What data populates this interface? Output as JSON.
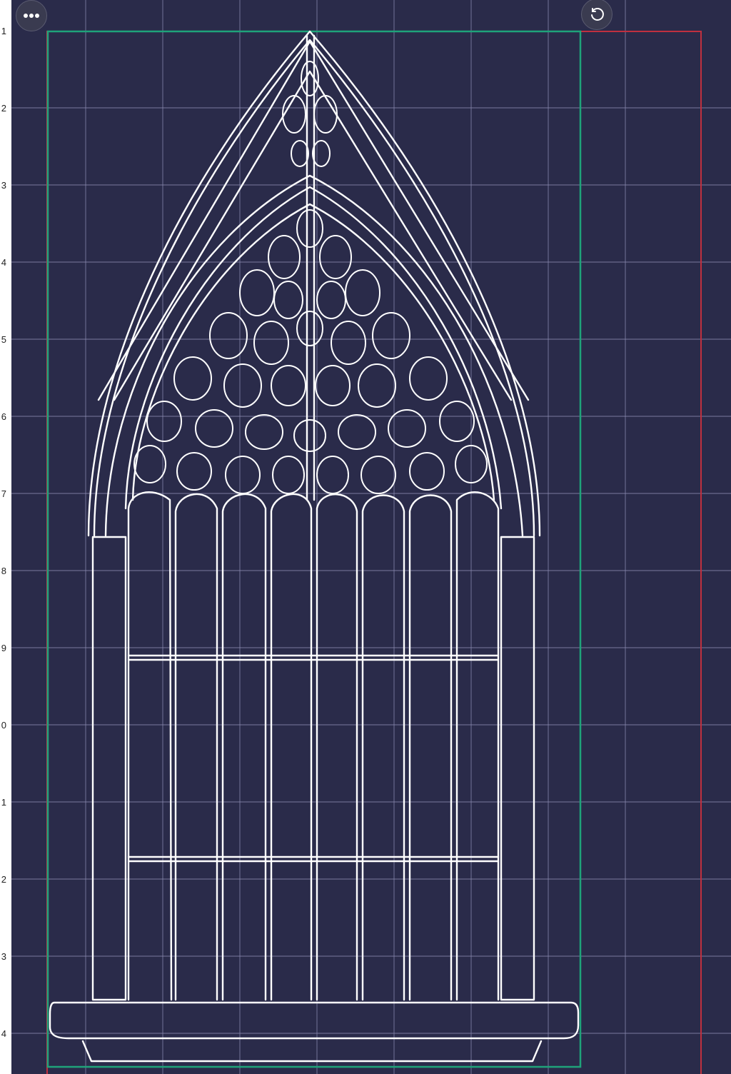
{
  "ruler": {
    "labels": [
      "1",
      "2",
      "3",
      "4",
      "5",
      "6",
      "7",
      "8",
      "9",
      "0",
      "1",
      "2",
      "3",
      "4"
    ]
  },
  "toolbar": {
    "more_icon": "more-horizontal-icon",
    "reset_icon": "rotate-reset-icon"
  },
  "colors": {
    "background": "#2a2b4a",
    "grid": "#8a8bb0",
    "design_border": "#1fa37a",
    "material_border": "#c0303f",
    "outline": "#ffffff"
  },
  "canvas": {
    "artwork": "gothic-window-outline"
  }
}
